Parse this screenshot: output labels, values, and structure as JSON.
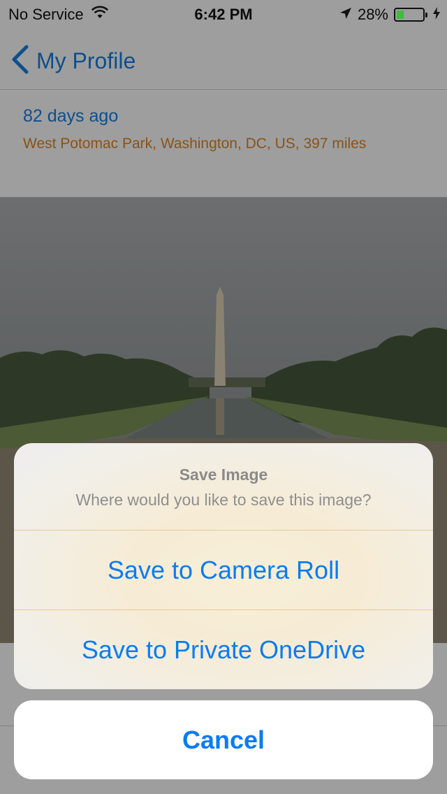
{
  "status_bar": {
    "carrier": "No Service",
    "time": "6:42 PM",
    "battery_percent": "28%",
    "battery_level": 0.28,
    "icons": [
      "wifi-icon",
      "location-arrow-icon",
      "battery-icon",
      "charging-bolt-icon"
    ]
  },
  "nav": {
    "back_label": "My Profile",
    "back_icon": "chevron-left-icon"
  },
  "post": {
    "time_ago": "82 days ago",
    "location": "West Potomac Park, Washington, DC, US, 397 miles"
  },
  "action_sheet": {
    "title": "Save Image",
    "message": "Where would you like to save this image?",
    "options": [
      "Save to Camera Roll",
      "Save to Private OneDrive"
    ],
    "cancel": "Cancel"
  },
  "colors": {
    "accent": "#0a7cf4",
    "location_text": "#8a5217",
    "battery_fill": "#3bbf3b"
  }
}
